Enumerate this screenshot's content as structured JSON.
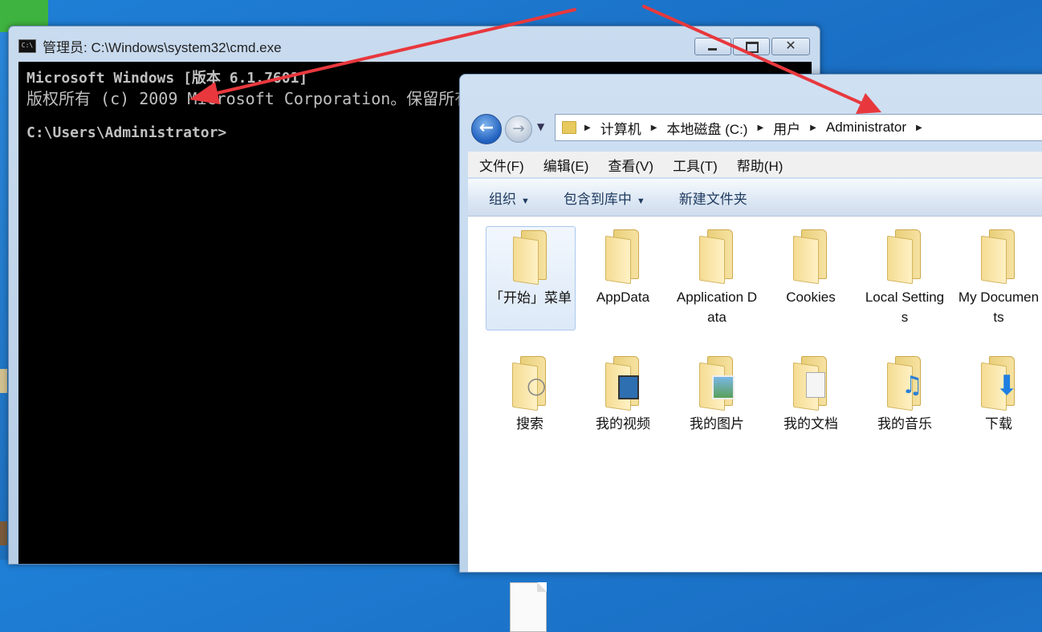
{
  "cmd": {
    "title": "管理员: C:\\Windows\\system32\\cmd.exe",
    "icon_text": "C:\\",
    "lines": [
      "Microsoft Windows [版本 6.1.7601]",
      "版权所有 (c) 2009 Microsoft Corporation。保留所有权利。",
      "C:\\Users\\Administrator>"
    ],
    "close_glyph": "✕"
  },
  "explorer": {
    "breadcrumb": [
      "计算机",
      "本地磁盘 (C:)",
      "用户",
      "Administrator"
    ],
    "menu": [
      "文件(F)",
      "编辑(E)",
      "查看(V)",
      "工具(T)",
      "帮助(H)"
    ],
    "toolbar": {
      "organize": "组织",
      "include_library": "包含到库中",
      "new_folder": "新建文件夹"
    },
    "items": [
      {
        "label": "「开始」菜单",
        "icon": "folder-icon"
      },
      {
        "label": "AppData",
        "icon": "folder-icon"
      },
      {
        "label": "Application Data",
        "icon": "folder-icon"
      },
      {
        "label": "Cookies",
        "icon": "folder-icon"
      },
      {
        "label": "Local Settings",
        "icon": "folder-icon"
      },
      {
        "label": "My Documents",
        "icon": "folder-icon"
      },
      {
        "label": "搜索",
        "icon": "search-folder-icon"
      },
      {
        "label": "我的视频",
        "icon": "videos-folder-icon"
      },
      {
        "label": "我的图片",
        "icon": "pictures-folder-icon"
      },
      {
        "label": "我的文档",
        "icon": "documents-folder-icon"
      },
      {
        "label": "我的音乐",
        "icon": "music-folder-icon"
      },
      {
        "label": "下载",
        "icon": "downloads-folder-icon"
      }
    ]
  },
  "annotation_color": "#e8383d"
}
